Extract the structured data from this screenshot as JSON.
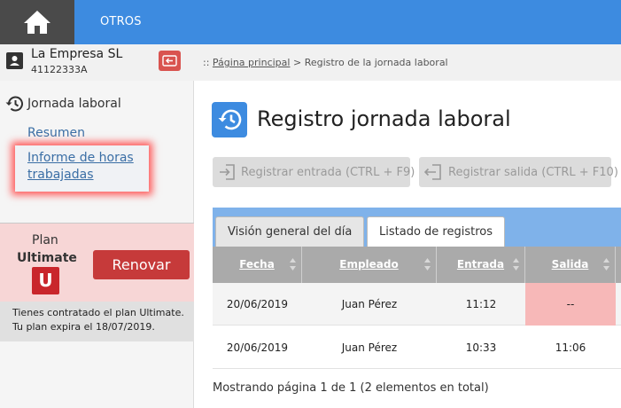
{
  "topnav": {
    "items": [
      "OTROS"
    ]
  },
  "company": {
    "name": "La Empresa SL",
    "id": "41122333A"
  },
  "breadcrumb": {
    "prefix": "::",
    "home": "Página principal",
    "separator": ">",
    "current": "Registro de la jornada laboral"
  },
  "sidebar": {
    "section": "Jornada laboral",
    "links": {
      "resumen": "Resumen",
      "informe": "Informe de horas trabajadas"
    }
  },
  "plan": {
    "label": "Plan",
    "name": "Ultimate",
    "logo_letter": "U",
    "renew_button": "Renovar",
    "info_line1": "Tienes contratado el plan Ultimate.",
    "info_line2": "Tu plan expira el 18/07/2019."
  },
  "page": {
    "title": "Registro jornada laboral"
  },
  "actions": {
    "entrada": "Registrar entrada (CTRL + F9)",
    "salida": "Registrar salida (CTRL + F10)"
  },
  "tabs": [
    "Visión general del día",
    "Listado de registros"
  ],
  "table": {
    "columns": [
      "Fecha",
      "Empleado",
      "Entrada",
      "Salida"
    ],
    "rows": [
      [
        "20/06/2019",
        "Juan Pérez",
        "11:12",
        "--"
      ],
      [
        "20/06/2019",
        "Juan Pérez",
        "10:33",
        "11:06"
      ]
    ]
  },
  "pager": {
    "text": "Mostrando página 1 de 1 (2 elementos en total)"
  },
  "colors": {
    "accent": "#3d8be0",
    "danger": "#c63a3a",
    "missing_cell": "#f7b8b8",
    "focus_glow": "#ff5d5d"
  }
}
